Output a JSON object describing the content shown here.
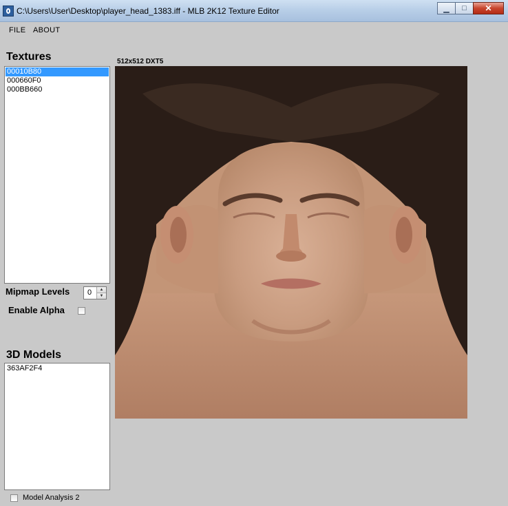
{
  "window": {
    "title": "C:\\Users\\User\\Desktop\\player_head_1383.iff - MLB 2K12 Texture Editor",
    "minimize_glyph": "▁",
    "maximize_glyph": "□",
    "close_glyph": "✕"
  },
  "menu": {
    "items": [
      {
        "label": "FILE"
      },
      {
        "label": "ABOUT"
      }
    ]
  },
  "textures": {
    "title": "Textures",
    "items": [
      {
        "label": "00010B80",
        "selected": true
      },
      {
        "label": "000660F0",
        "selected": false
      },
      {
        "label": "000BB660",
        "selected": false
      }
    ]
  },
  "mipmap": {
    "label": "Mipmap Levels",
    "value": "0"
  },
  "alpha": {
    "label": "Enable Alpha",
    "checked": false
  },
  "models": {
    "title": "3D Models",
    "items": [
      {
        "label": "363AF2F4"
      }
    ]
  },
  "model_analysis": {
    "label": "Model Analysis 2",
    "checked": false
  },
  "texture_view": {
    "info": "512x512 DXT5"
  },
  "colors": {
    "background": "#c9c9c9",
    "selection": "#3399ff",
    "hair": "#2a1d17",
    "skin": "#c8997c"
  }
}
